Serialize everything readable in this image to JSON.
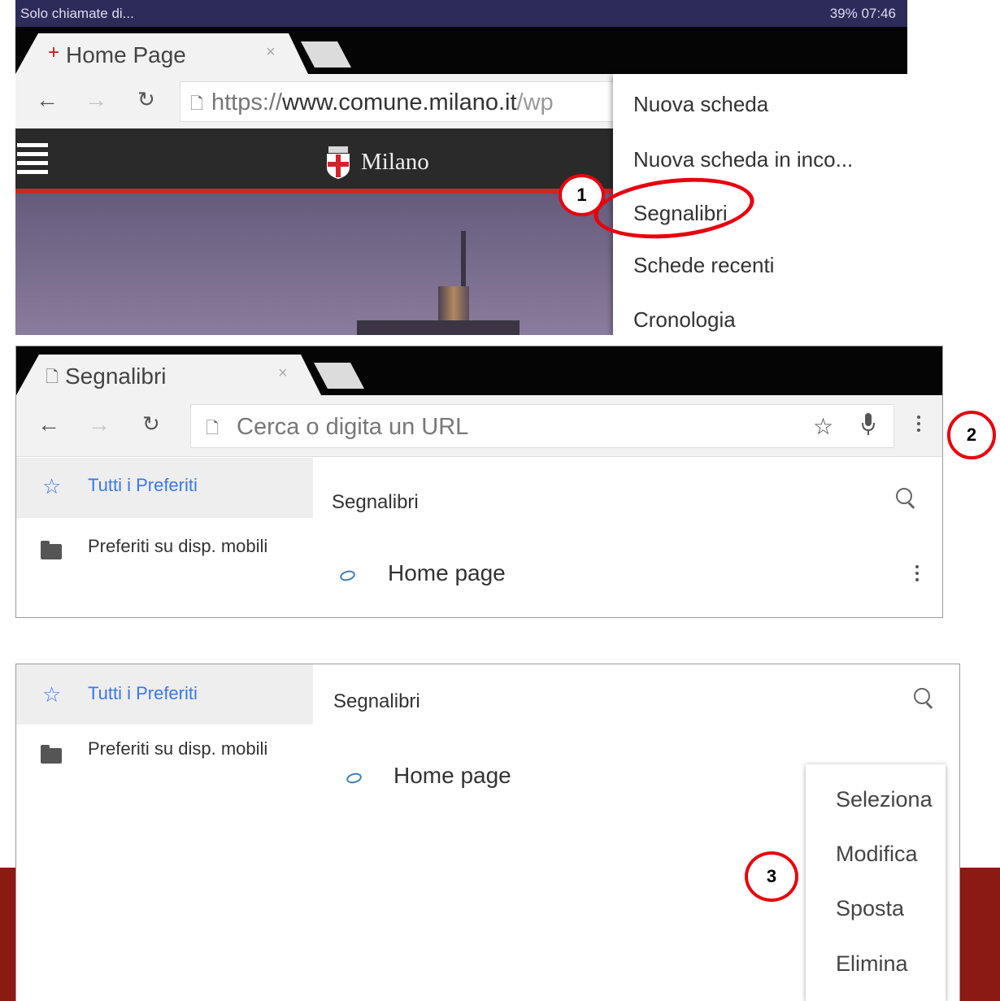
{
  "panel1": {
    "status_left": "Solo chiamate di...",
    "status_right": "39% 07:46",
    "tab_title": "Home Page",
    "tab_close": "×",
    "url_scheme": "https://",
    "url_host": "www.comune.milano.it",
    "url_path": "/wp",
    "site_name": "Milano",
    "menu": [
      "Nuova scheda",
      "Nuova scheda in inco...",
      "Segnalibri",
      "Schede recenti",
      "Cronologia"
    ]
  },
  "panel2": {
    "tab_title": "Segnalibri",
    "tab_close": "×",
    "url_placeholder": "Cerca o digita un URL",
    "sidebar": [
      "Tutti i Preferiti",
      "Preferiti su disp. mobili"
    ],
    "main_title": "Segnalibri",
    "bookmarks": [
      "Home page"
    ]
  },
  "panel3": {
    "sidebar": [
      "Tutti i Preferiti",
      "Preferiti su disp. mobili"
    ],
    "main_title": "Segnalibri",
    "bookmarks": [
      "Home page"
    ],
    "context_menu": [
      "Seleziona",
      "Modifica",
      "Sposta",
      "Elimina"
    ]
  },
  "callouts": [
    "1",
    "2",
    "3"
  ],
  "colors": {
    "accent_red": "#e8000d",
    "link_blue": "#3b78e7",
    "milano_red": "#d2232a",
    "bar_dark_red": "#8b1a12"
  },
  "icons": {
    "back": "back-arrow-icon",
    "forward": "forward-arrow-icon",
    "reload": "reload-icon",
    "page": "page-icon",
    "star": "star-icon",
    "mic": "mic-icon",
    "more": "kebab-menu-icon",
    "search": "search-icon",
    "folder": "folder-icon",
    "bookmark": "bookmark-favicon-icon",
    "menu": "hamburger-icon"
  }
}
